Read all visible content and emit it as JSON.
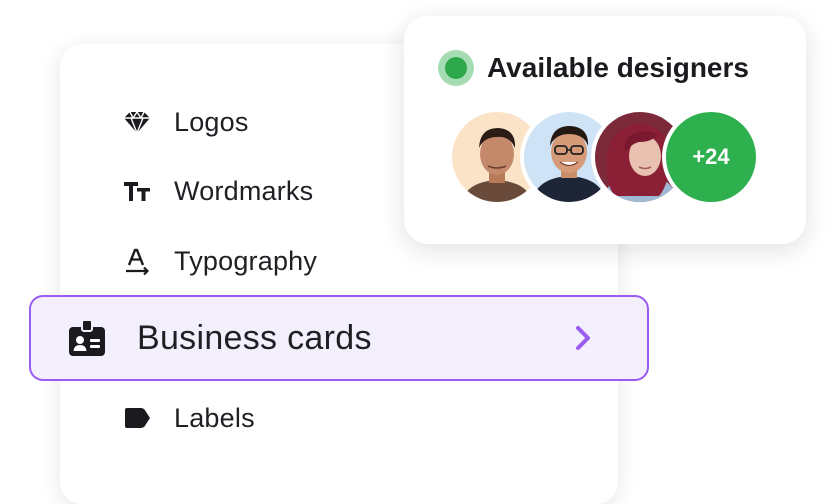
{
  "menu": {
    "items": [
      {
        "label": "Logos",
        "icon": "diamond-icon"
      },
      {
        "label": "Wordmarks",
        "icon": "text-size-icon"
      },
      {
        "label": "Typography",
        "icon": "typography-icon"
      },
      {
        "label": "Business cards",
        "icon": "id-badge-icon",
        "selected": true
      },
      {
        "label": "Labels",
        "icon": "tag-icon"
      }
    ]
  },
  "designers": {
    "title": "Available designers",
    "status_color": "#2ea84a",
    "more_count": "+24",
    "avatars": [
      "designer-avatar-1",
      "designer-avatar-2",
      "designer-avatar-3"
    ]
  },
  "colors": {
    "accent": "#9a5cf0",
    "selected_bg": "#f4effd",
    "online_green": "#2fb04e"
  }
}
